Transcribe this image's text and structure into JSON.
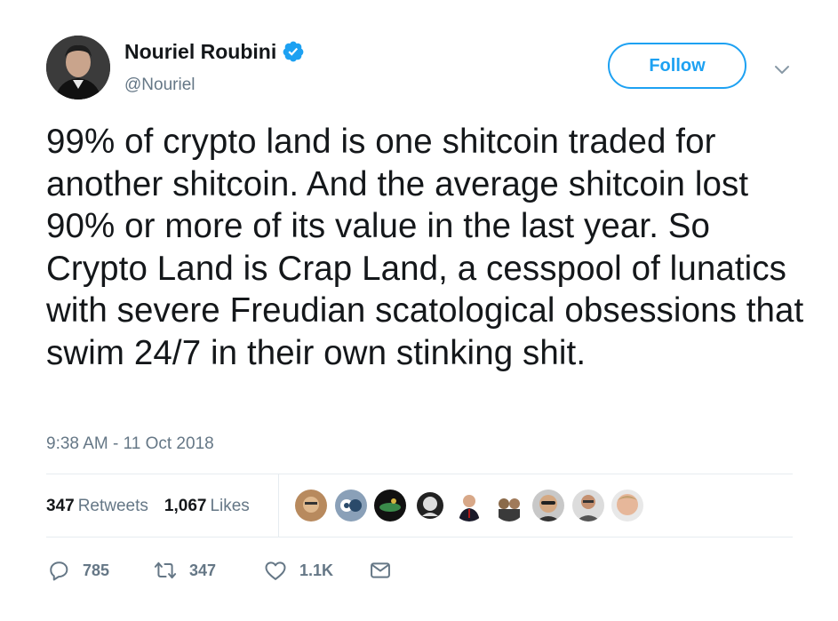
{
  "author": {
    "display_name": "Nouriel Roubini",
    "handle": "@Nouriel",
    "verified": true
  },
  "follow_label": "Follow",
  "tweet": {
    "text": "99% of crypto land is one shitcoin traded for another shitcoin. And the average shitcoin lost 90% or more of its value in the last year. So Crypto Land is Crap Land, a cesspool of lunatics with severe Freudian scatological obsessions that swim 24/7 in their own stinking shit.",
    "timestamp": "9:38 AM - 11 Oct 2018"
  },
  "stats": {
    "retweets_count": "347",
    "retweets_label": "Retweets",
    "likes_count": "1,067",
    "likes_label": "Likes"
  },
  "likers": [
    {
      "name": "liker-avatar-1"
    },
    {
      "name": "liker-avatar-2"
    },
    {
      "name": "liker-avatar-3"
    },
    {
      "name": "liker-avatar-4"
    },
    {
      "name": "liker-avatar-5"
    },
    {
      "name": "liker-avatar-6"
    },
    {
      "name": "liker-avatar-7"
    },
    {
      "name": "liker-avatar-8"
    },
    {
      "name": "liker-avatar-9"
    }
  ],
  "actions": {
    "reply_count": "785",
    "retweet_count": "347",
    "like_count": "1.1K"
  },
  "colors": {
    "accent": "#1da1f2",
    "text": "#14171a",
    "muted": "#657786",
    "divider": "#e6ecf0"
  }
}
